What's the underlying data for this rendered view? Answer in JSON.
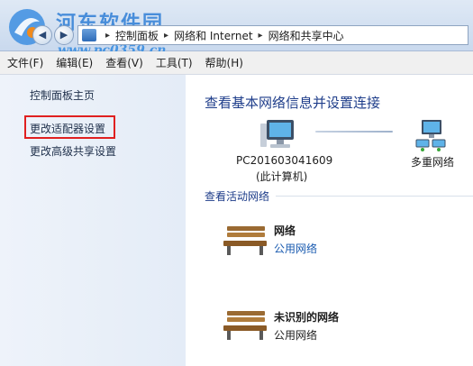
{
  "watermark": {
    "title": "河东软件园",
    "url": "www.pc0359.cn"
  },
  "nav": {
    "back_glyph": "◀",
    "forward_glyph": "▶"
  },
  "address": {
    "crumbs": [
      "控制面板",
      "网络和 Internet",
      "网络和共享中心"
    ],
    "separator": "▸"
  },
  "menu": {
    "items": [
      "文件(F)",
      "编辑(E)",
      "查看(V)",
      "工具(T)",
      "帮助(H)"
    ]
  },
  "sidebar": {
    "items": [
      {
        "label": "控制面板主页"
      },
      {
        "label": "更改适配器设置",
        "highlighted": true
      },
      {
        "label": "更改高级共享设置"
      }
    ]
  },
  "main": {
    "heading": "查看基本网络信息并设置连接",
    "map": {
      "computer_name": "PC201603041609",
      "computer_sub": "(此计算机)",
      "network_label": "多重网络"
    },
    "active_section_title": "查看活动网络",
    "networks": [
      {
        "name": "网络",
        "type": "公用网络",
        "type_is_link": true
      },
      {
        "name": "未识别的网络",
        "type": "公用网络",
        "type_is_link": false
      }
    ]
  },
  "colors": {
    "accent_heading": "#1e3d8a",
    "link": "#1a5bb0",
    "highlight_border": "#e02020",
    "watermark": "#2f7fd6"
  }
}
